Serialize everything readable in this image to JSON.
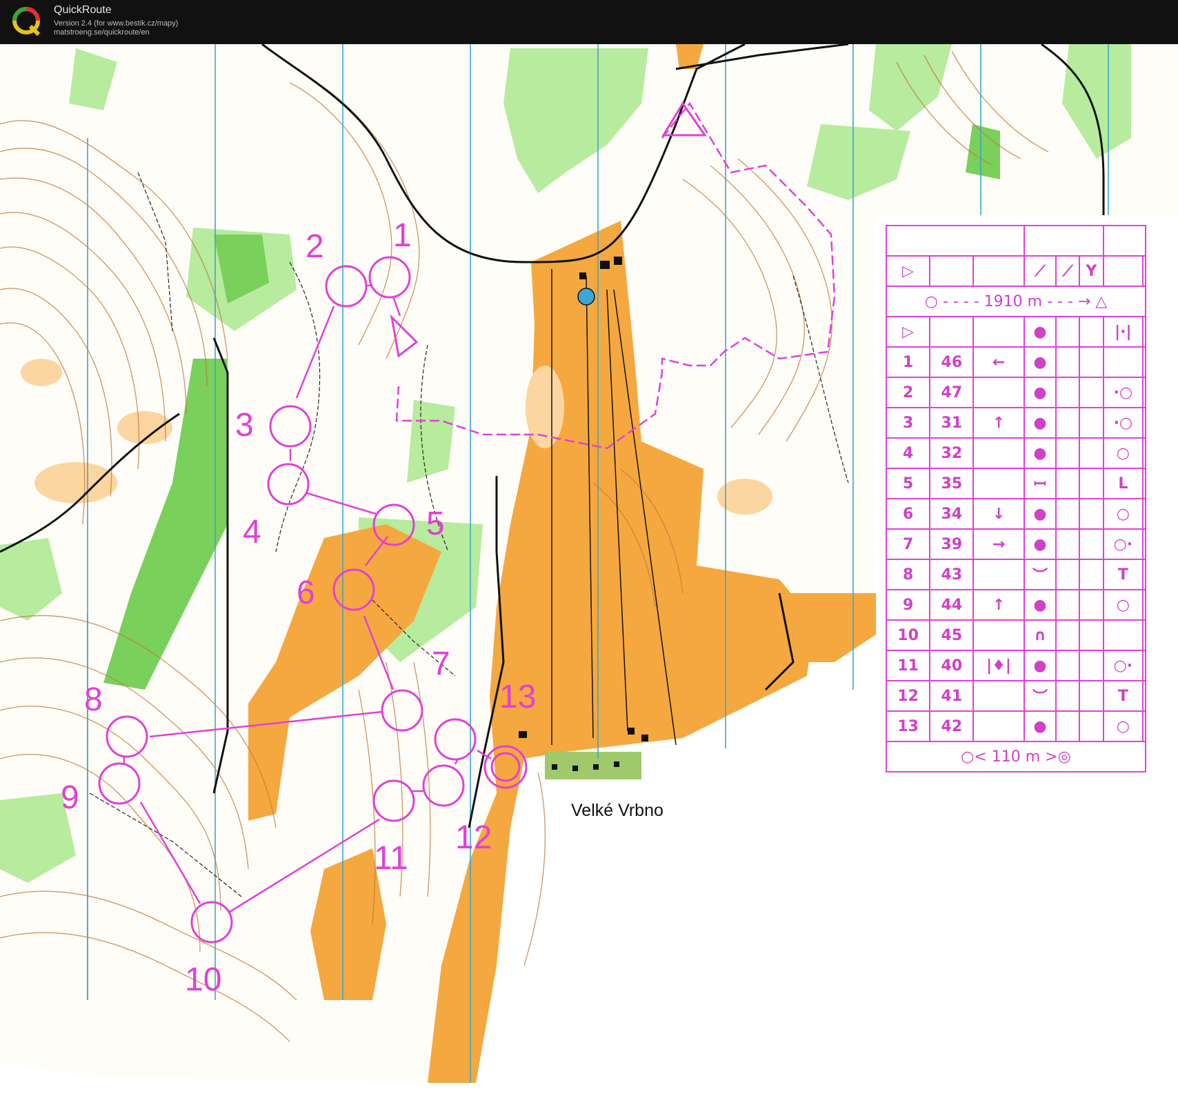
{
  "app": {
    "title": "QuickRoute",
    "version_line": "Version 2.4  (for www.bestik.cz/mapy)",
    "url_line": "matstroeng.se/quickroute/en"
  },
  "map": {
    "place_label": "Velké Vrbno",
    "control_numbers": [
      "1",
      "2",
      "3",
      "4",
      "5",
      "6",
      "7",
      "8",
      "9",
      "10",
      "11",
      "12",
      "13"
    ],
    "colors": {
      "course": "#e040d8",
      "open_land": "#f6a940",
      "vegetation": "#8ad66a",
      "contour": "#b5652a",
      "water_line": "#3aa7c8"
    }
  },
  "control_description": {
    "course_length": "1910 m",
    "finish_distance": "110 m",
    "controls": [
      {
        "num": "1",
        "code": "46",
        "dir": "←",
        "feature": "●",
        "extra": ""
      },
      {
        "num": "2",
        "code": "47",
        "dir": "",
        "feature": "●",
        "extra": "·○"
      },
      {
        "num": "3",
        "code": "31",
        "dir": "↑",
        "feature": "●",
        "extra": "·○"
      },
      {
        "num": "4",
        "code": "32",
        "dir": "",
        "feature": "●",
        "extra": "○"
      },
      {
        "num": "5",
        "code": "35",
        "dir": "",
        "feature": "ꟷ",
        "extra": "L"
      },
      {
        "num": "6",
        "code": "34",
        "dir": "↓",
        "feature": "●",
        "extra": "○"
      },
      {
        "num": "7",
        "code": "39",
        "dir": "→",
        "feature": "●",
        "extra": "○·"
      },
      {
        "num": "8",
        "code": "43",
        "dir": "",
        "feature": "︶",
        "extra": "T"
      },
      {
        "num": "9",
        "code": "44",
        "dir": "↑",
        "feature": "●",
        "extra": "○"
      },
      {
        "num": "10",
        "code": "45",
        "dir": "",
        "feature": "∩",
        "extra": ""
      },
      {
        "num": "11",
        "code": "40",
        "dir": "|♦|",
        "feature": "●",
        "extra": "○·"
      },
      {
        "num": "12",
        "code": "41",
        "dir": "",
        "feature": "︶",
        "extra": "T"
      },
      {
        "num": "13",
        "code": "42",
        "dir": "",
        "feature": "●",
        "extra": "○"
      }
    ]
  }
}
